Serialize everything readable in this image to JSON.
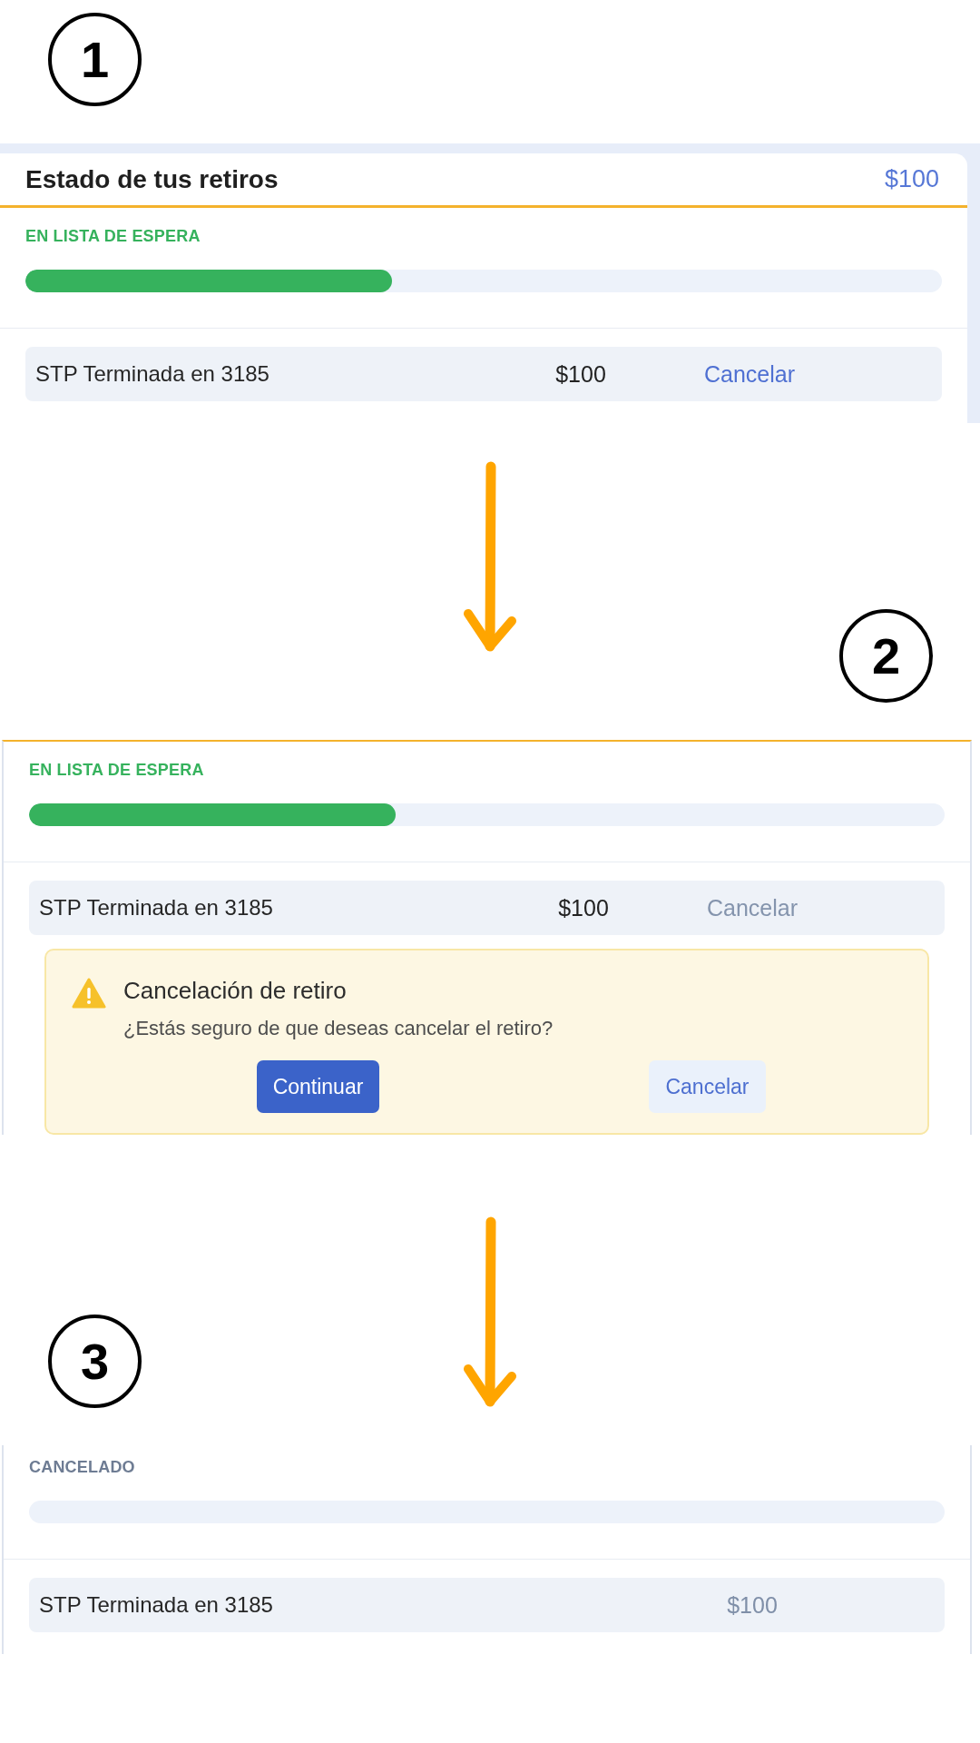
{
  "steps": [
    {
      "number": "1",
      "panel": {
        "kind": "card",
        "header": {
          "title": "Estado de tus retiros",
          "total": "$100"
        },
        "header_rule": true,
        "status": {
          "label": "EN LISTA DE ESPERA",
          "kind": "waiting"
        },
        "progress": {
          "level": 0.4
        },
        "rows": [
          {
            "account": "STP Terminada en 3185",
            "amount": "$100",
            "action": {
              "label": "Cancelar",
              "disabled": false
            }
          }
        ]
      }
    },
    {
      "number": "2",
      "panel": {
        "kind": "cropped",
        "header_rule": true,
        "status": {
          "label": "EN LISTA DE ESPERA",
          "kind": "waiting"
        },
        "progress": {
          "level": 0.4
        },
        "rows": [
          {
            "account": "STP Terminada en 3185",
            "amount": "$100",
            "action": {
              "label": "Cancelar",
              "disabled": true
            }
          }
        ],
        "alert": {
          "title": "Cancelación de retiro",
          "message": "¿Estás seguro de que deseas cancelar el retiro?",
          "buttons": [
            {
              "label": "Continuar",
              "kind": "primary"
            },
            {
              "label": "Cancelar",
              "kind": "secondary"
            }
          ]
        }
      }
    },
    {
      "number": "3",
      "panel": {
        "kind": "cropped",
        "header_rule": false,
        "status": {
          "label": "CANCELADO",
          "kind": "cancelled"
        },
        "progress": {
          "level": 0
        },
        "rows": [
          {
            "account": "STP Terminada en 3185",
            "amount": "$100"
          }
        ]
      }
    }
  ]
}
